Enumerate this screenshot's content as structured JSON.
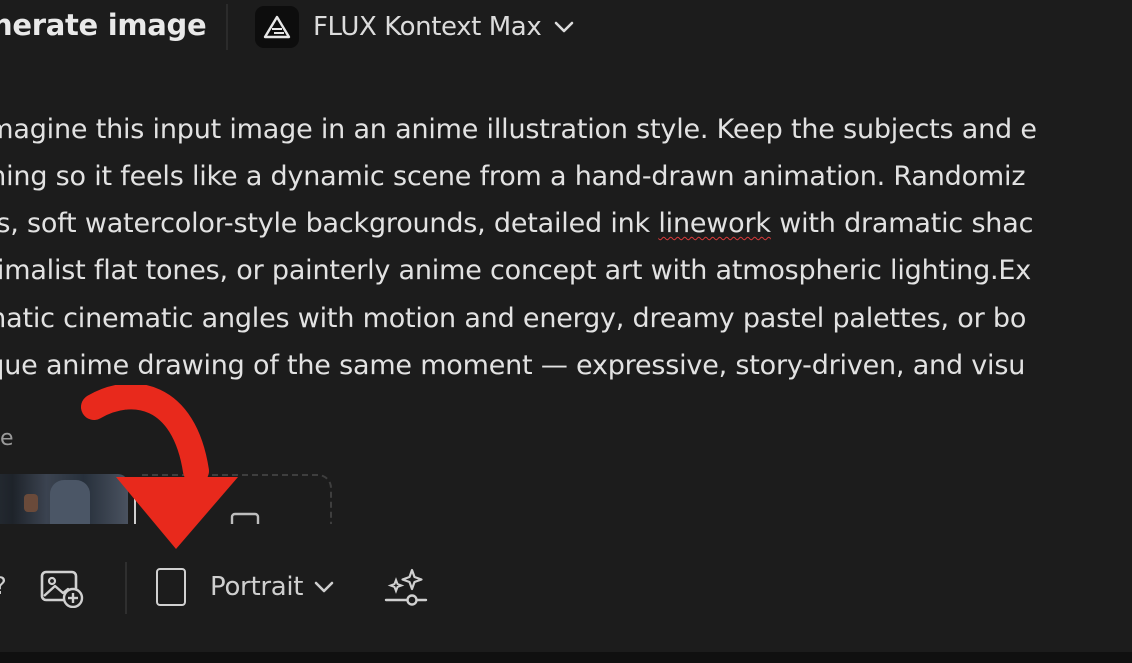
{
  "header": {
    "title": "nerate image",
    "model": {
      "name": "FLUX Kontext Max",
      "logo_icon": "flux-logo-icon",
      "chevron_icon": "chevron-down-icon"
    }
  },
  "prompt": {
    "lines": [
      "imagine this input image in an anime illustration style. Keep the subjects and e",
      "ming so it feels like a dynamic scene from a hand-drawn animation. Randomiz",
      "es, soft watercolor-style backgrounds, detailed ink ",
      "nimalist flat tones, or painterly anime concept art with atmospheric lighting.Ex",
      "matic cinematic angles with motion and energy, dreamy pastel palettes, or bo",
      "ique anime drawing of the same moment — expressive, story-driven, and visu"
    ],
    "line3_misspelled": "linework",
    "line3_tail": " with dramatic shac"
  },
  "reference": {
    "label": "ge"
  },
  "toolbar": {
    "edge_glyph": "?",
    "image_icon": "add-image-icon",
    "aspect_ratio": {
      "icon": "portrait-frame-icon",
      "label": "Portrait",
      "chevron_icon": "chevron-down-icon"
    },
    "effects_icon": "style-effects-icon"
  },
  "annotation": {
    "arrow_icon": "red-curved-arrow-icon",
    "color": "#e8291c"
  },
  "colors": {
    "background": "#1c1c1c",
    "text": "#e2e2e2",
    "muted": "#9a9a9a",
    "spellcheck": "#d93a3a"
  }
}
